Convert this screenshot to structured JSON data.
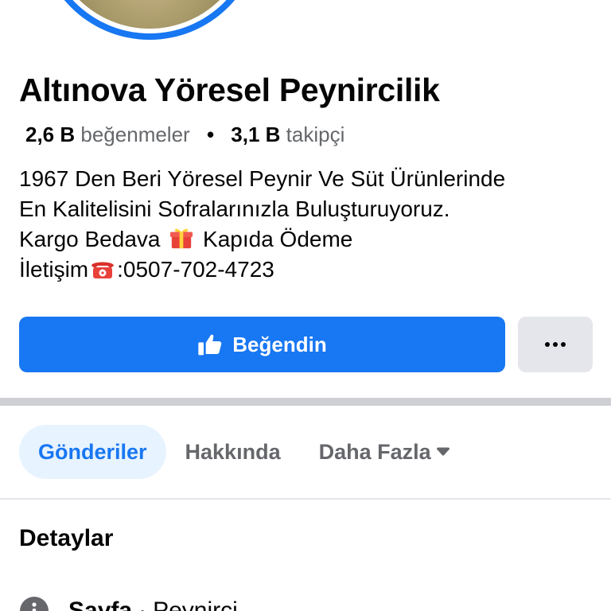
{
  "page": {
    "title": "Altınova Yöresel Peynircilik",
    "likes_count": "2,6 B",
    "likes_label": "beğenmeler",
    "followers_count": "3,1 B",
    "followers_label": "takipçi",
    "stats_separator": "•"
  },
  "bio": {
    "line1": "1967 Den Beri Yöresel Peynir Ve Süt Ürünlerinde",
    "line2": "En Kalitelisini Sofralarınızla Buluşturuyoruz.",
    "line3_a": "Kargo Bedava",
    "line3_b": "Kapıda Ödeme",
    "line4_a": "İletişim",
    "line4_b": ":0507-702-4723"
  },
  "actions": {
    "like_label": "Beğendin",
    "more_label": "···"
  },
  "tabs": [
    {
      "label": "Gönderiler"
    },
    {
      "label": "Hakkında"
    },
    {
      "label": "Daha Fazla"
    }
  ],
  "details": {
    "title": "Detaylar",
    "row_label": "Sayfa",
    "row_sep": "·",
    "row_value": "Peynirci"
  },
  "colors": {
    "accent": "#1877f2",
    "secondary_button": "#e4e6eb",
    "active_tab_bg": "#e7f3ff",
    "muted_text": "#65676b"
  },
  "icons": {
    "like": "thumbs-up-icon",
    "gift": "gift-emoji-icon",
    "phone": "telephone-emoji-icon",
    "caret": "caret-down-icon",
    "info": "info-icon"
  }
}
